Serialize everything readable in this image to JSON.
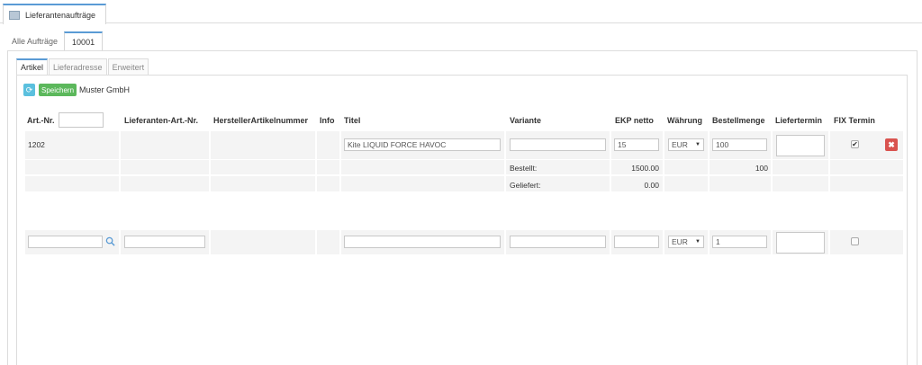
{
  "window": {
    "tab_title": "Lieferantenaufträge"
  },
  "order_tabs": [
    {
      "label": "Alle Aufträge"
    },
    {
      "label": "10001"
    }
  ],
  "sub_tabs": [
    {
      "label": "Artikel"
    },
    {
      "label": "Lieferadresse"
    },
    {
      "label": "Erweitert"
    }
  ],
  "toolbar": {
    "save_label": "Speichern",
    "supplier_name": "Muster GmbH"
  },
  "table": {
    "headers": {
      "art_nr": "Art.-Nr.",
      "supplier_art_nr": "Lieferanten-Art.-Nr.",
      "manufacturer_art_nr": "HerstellerArtikelnummer",
      "info": "Info",
      "title": "Titel",
      "variant": "Variante",
      "ekp_netto": "EKP netto",
      "currency": "Währung",
      "order_qty": "Bestellmenge",
      "delivery_date": "Liefertermin",
      "fix_date": "FIX Termin"
    },
    "item_row": {
      "art_nr": "1202",
      "title": "Kite LIQUID FORCE HAVOC",
      "variant": "",
      "ekp_netto": "15",
      "currency": "EUR",
      "order_qty": "100",
      "delivery_date": "",
      "fix_checked": true,
      "fix_mark": "✔"
    },
    "ordered_row": {
      "label": "Bestellt:",
      "ekp_value": "1500.00",
      "qty_value": "100"
    },
    "delivered_row": {
      "label": "Geliefert:",
      "ekp_value": "0.00"
    },
    "new_row": {
      "art_nr": "",
      "supplier_art_nr": "",
      "title": "",
      "variant": "",
      "ekp_netto": "",
      "currency": "EUR",
      "order_qty": "1",
      "delivery_date": "",
      "fix_checked": false
    }
  },
  "colors": {
    "accent": "#5a9bd5",
    "save": "#5cb85c",
    "refresh": "#5bc0de",
    "delete": "#d9534f"
  },
  "icons": {
    "refresh": "refresh-icon",
    "search": "search-icon",
    "delete": "times-icon",
    "window": "window-icon"
  }
}
